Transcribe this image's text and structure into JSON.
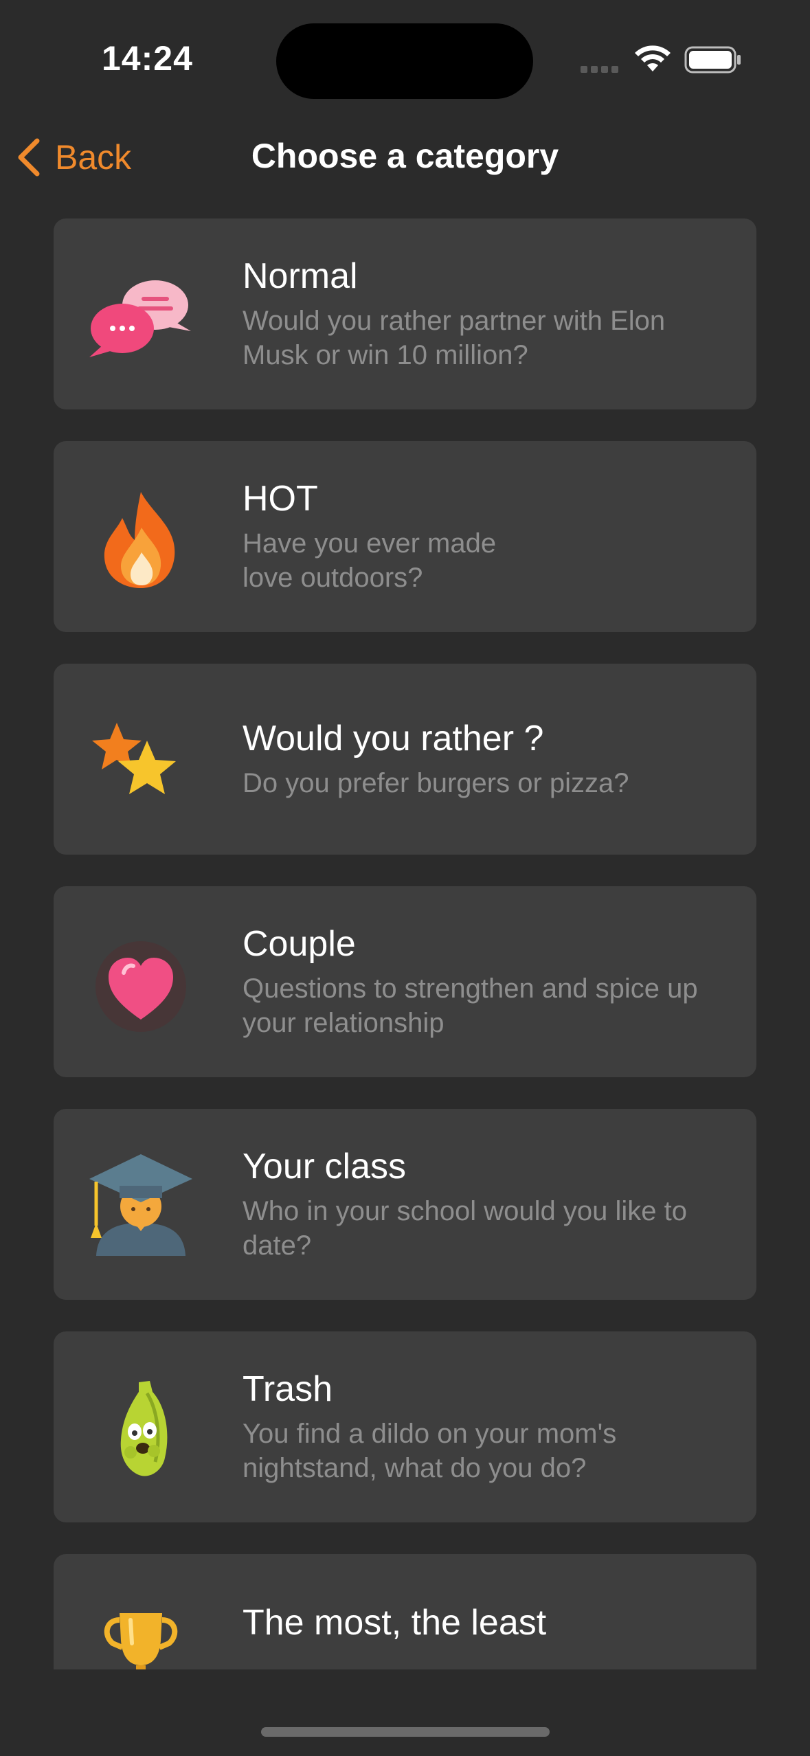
{
  "status_bar": {
    "time": "14:24",
    "battery_icon": "battery-full-icon",
    "wifi_icon": "wifi-icon"
  },
  "nav": {
    "back_label": "Back",
    "title": "Choose a category",
    "accent_color": "#f08a2c"
  },
  "categories": [
    {
      "title": "Normal",
      "description": "Would you rather partner with Elon Musk or win 10 million?",
      "icon": "chat-bubbles-icon"
    },
    {
      "title": "HOT",
      "description": "Have you ever made love outdoors?",
      "icon": "fire-icon"
    },
    {
      "title": "Would you rather ?",
      "description": "Do you prefer burgers or pizza?",
      "icon": "stars-icon"
    },
    {
      "title": "Couple",
      "description": "Questions to strengthen and spice up your relationship",
      "icon": "heart-icon"
    },
    {
      "title": "Your class",
      "description": "Who in your school would you like to date?",
      "icon": "graduate-icon"
    },
    {
      "title": "Trash",
      "description": "You find a dildo on your mom's nightstand, what do you do?",
      "icon": "banana-icon"
    },
    {
      "title": "The most, the least",
      "description": "",
      "icon": "trophy-icon"
    }
  ]
}
